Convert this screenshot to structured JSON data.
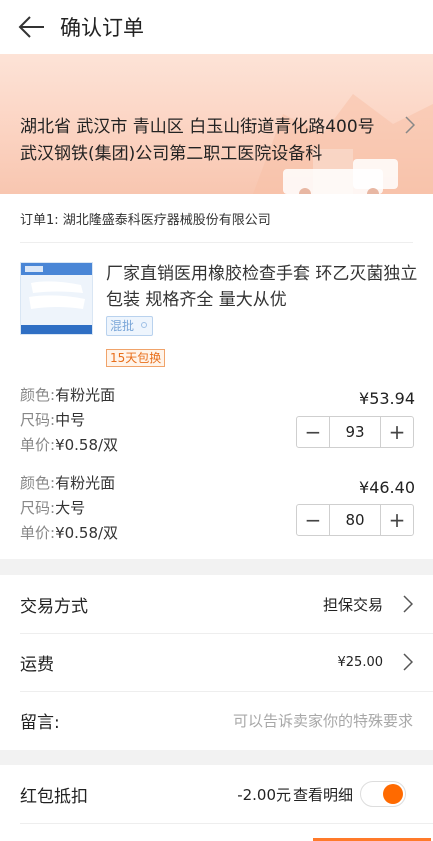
{
  "header": {
    "title": "确认订单"
  },
  "address": {
    "text": "湖北省 武汉市 青山区 白玉山街道青化路400号武汉钢铁(集团)公司第二职工医院设备科"
  },
  "order": {
    "shop": "订单1: 湖北隆盛泰科医疗器械股份有限公司",
    "product_title": "厂家直销医用橡胶检查手套 环乙灭菌独立包装 规格齐全 量大从优",
    "tag_mix": "混批",
    "tag_return": "15天包换",
    "skus": [
      {
        "color_label": "颜色:",
        "color": "有粉光面",
        "size_label": "尺码:",
        "size": "中号",
        "unit_label": "单价:",
        "unit": "¥0.58/双",
        "price": "¥53.94",
        "qty": "93"
      },
      {
        "color_label": "颜色:",
        "color": "有粉光面",
        "size_label": "尺码:",
        "size": "大号",
        "unit_label": "单价:",
        "unit": "¥0.58/双",
        "price": "¥46.40",
        "qty": "80"
      }
    ]
  },
  "trade": {
    "label": "交易方式",
    "value": "担保交易"
  },
  "shipping": {
    "label": "运费",
    "value": "¥25.00"
  },
  "message": {
    "label": "留言:",
    "placeholder": "可以告诉卖家你的特殊要求"
  },
  "redpacket": {
    "label": "红包抵扣",
    "value": "-2.00元",
    "detail": "查看明细",
    "toggle_on": true
  },
  "colors": {
    "accent": "#ff6a00",
    "banner": "#fbd2c0"
  }
}
